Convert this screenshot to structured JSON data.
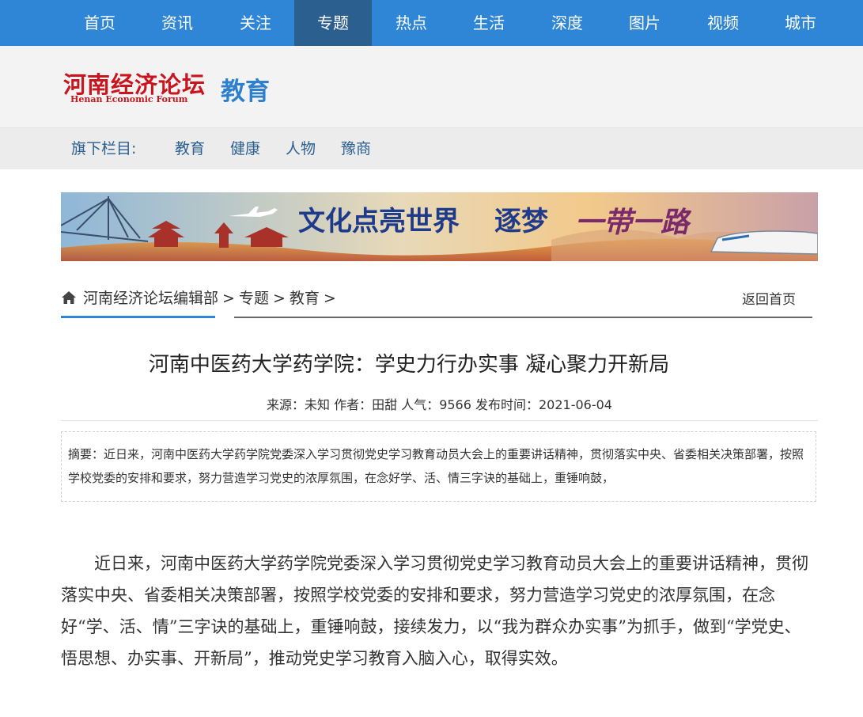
{
  "top_nav": {
    "items": [
      {
        "label": "首页"
      },
      {
        "label": "资讯"
      },
      {
        "label": "关注"
      },
      {
        "label": "专题",
        "active": true
      },
      {
        "label": "热点"
      },
      {
        "label": "生活"
      },
      {
        "label": "深度"
      },
      {
        "label": "图片"
      },
      {
        "label": "视频"
      },
      {
        "label": "城市"
      }
    ]
  },
  "brand": {
    "logo_cn": "河南经济论坛",
    "logo_en": "Henan Economic Forum",
    "section_title": "教育"
  },
  "sub_nav": {
    "label": "旗下栏目:",
    "items": [
      {
        "label": "教育"
      },
      {
        "label": "健康"
      },
      {
        "label": "人物"
      },
      {
        "label": "豫商"
      }
    ]
  },
  "banner": {
    "text_main": "文化点亮世界",
    "text_second": "逐梦",
    "text_script": "一带一路"
  },
  "breadcrumb": {
    "items": [
      "河南经济论坛编辑部",
      "专题",
      "教育"
    ],
    "separator": ">",
    "back_label": "返回首页"
  },
  "article": {
    "title": "河南中医药大学药学院：学史力行办实事 凝心聚力开新局",
    "meta": "来源：未知 作者：田甜 人气：9566 发布时间：2021-06-04",
    "summary": "摘要：近日来，河南中医药大学药学院党委深入学习贯彻党史学习教育动员大会上的重要讲话精神，贯彻落实中央、省委相关决策部署，按照学校党委的安排和要求，努力营造学习党史的浓厚氛围，在念好学、活、情三字诀的基础上，重锤响鼓，",
    "body": "近日来，河南中医药大学药学院党委深入学习贯彻党史学习教育动员大会上的重要讲话精神，贯彻落实中央、省委相关决策部署，按照学校党委的安排和要求，努力营造学习党史的浓厚氛围，在念好“学、活、情”三字诀的基础上，重锤响鼓，接续发力，以“我为群众办实事”为抓手，做到“学党史、悟思想、办实事、开新局”，推动党史学习教育入脑入心，取得实效。"
  },
  "colors": {
    "nav_bg": "#2f86d6",
    "nav_active_bg": "#2b5f8f",
    "logo_red": "#c9151e",
    "section_blue": "#2f7fcf"
  }
}
